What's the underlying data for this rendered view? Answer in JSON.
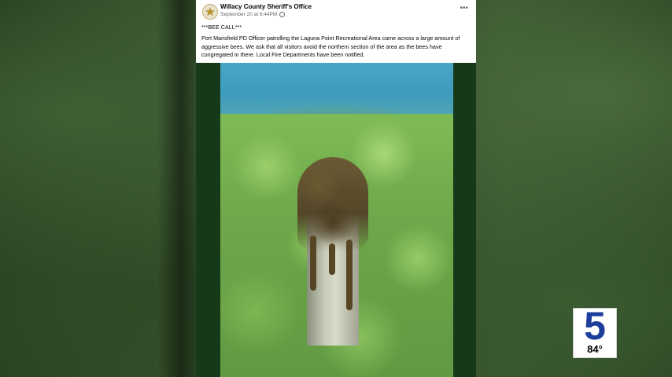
{
  "post": {
    "page_name": "Willacy County Sheriff's Office",
    "timestamp": "September 20 at 6:44PM",
    "more_icon": "more-horizontal-icon",
    "headline": "***BEE CALL***",
    "body": "Port Mansfield PD Officer patrolling the Laguna Point Recreational Area came across a large amount of aggressive bees. We ask that all visitors avoid the northern section of the area as the bees have congregated in there. Local Fire Departments have been notified."
  },
  "station_logo": {
    "channel": "5",
    "temperature": "84°"
  },
  "colors": {
    "logo_blue": "#1d3e9c",
    "post_frame_green": "#16391a"
  }
}
